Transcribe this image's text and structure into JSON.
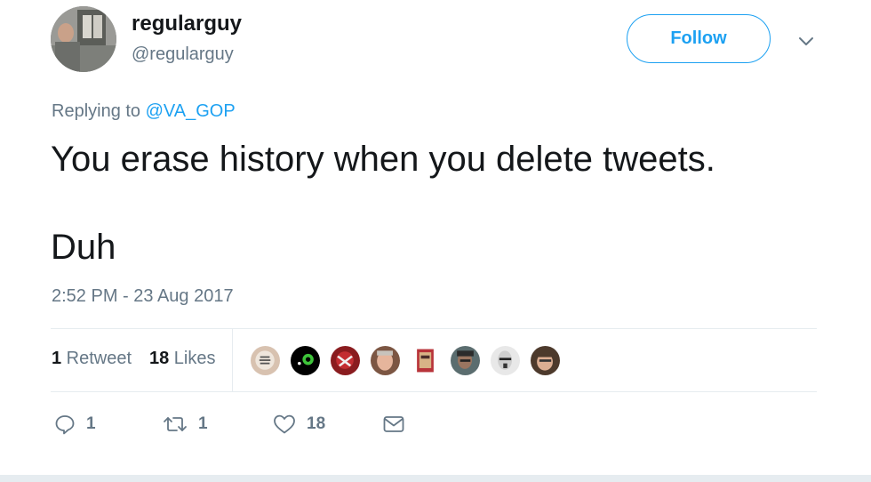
{
  "user": {
    "display_name": "regularguy",
    "handle": "@regularguy"
  },
  "follow_label": "Follow",
  "reply": {
    "prefix": "Replying to ",
    "mention": "@VA_GOP"
  },
  "tweet": {
    "line1": "You erase history when you delete tweets.",
    "line2": "Duh"
  },
  "timestamp": "2:52 PM - 23 Aug 2017",
  "stats": {
    "retweets_count": "1",
    "retweets_label": " Retweet",
    "likes_count": "18",
    "likes_label": " Likes"
  },
  "actions": {
    "reply_count": "1",
    "retweet_count": "1",
    "like_count": "18"
  },
  "colors": {
    "accent": "#1da1f2",
    "secondary_text": "#657786",
    "primary_text": "#14171a",
    "divider": "#e6ecf0"
  },
  "icons": [
    "chevron-down-icon",
    "reply-icon",
    "retweet-icon",
    "heart-icon",
    "message-icon"
  ]
}
